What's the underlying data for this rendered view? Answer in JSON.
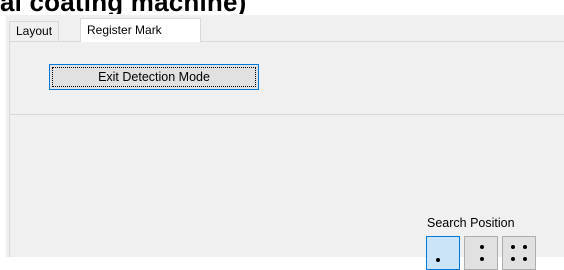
{
  "heading": {
    "text": "al coating machine)"
  },
  "tabs": [
    {
      "label": "Layout",
      "active": false
    },
    {
      "label": "Register Mark",
      "active": true
    }
  ],
  "panel": {
    "exit_button_label": "Exit Detection Mode",
    "search_position": {
      "label": "Search Position",
      "options": [
        {
          "icon": "one-dot-icon",
          "selected": true
        },
        {
          "icon": "two-dots-vertical-icon",
          "selected": false
        },
        {
          "icon": "four-dots-icon",
          "selected": false
        }
      ]
    }
  },
  "colors": {
    "selection_accent": "#0078d7",
    "selected_fill": "#cce4f7",
    "window_background": "#f0f0f0"
  }
}
